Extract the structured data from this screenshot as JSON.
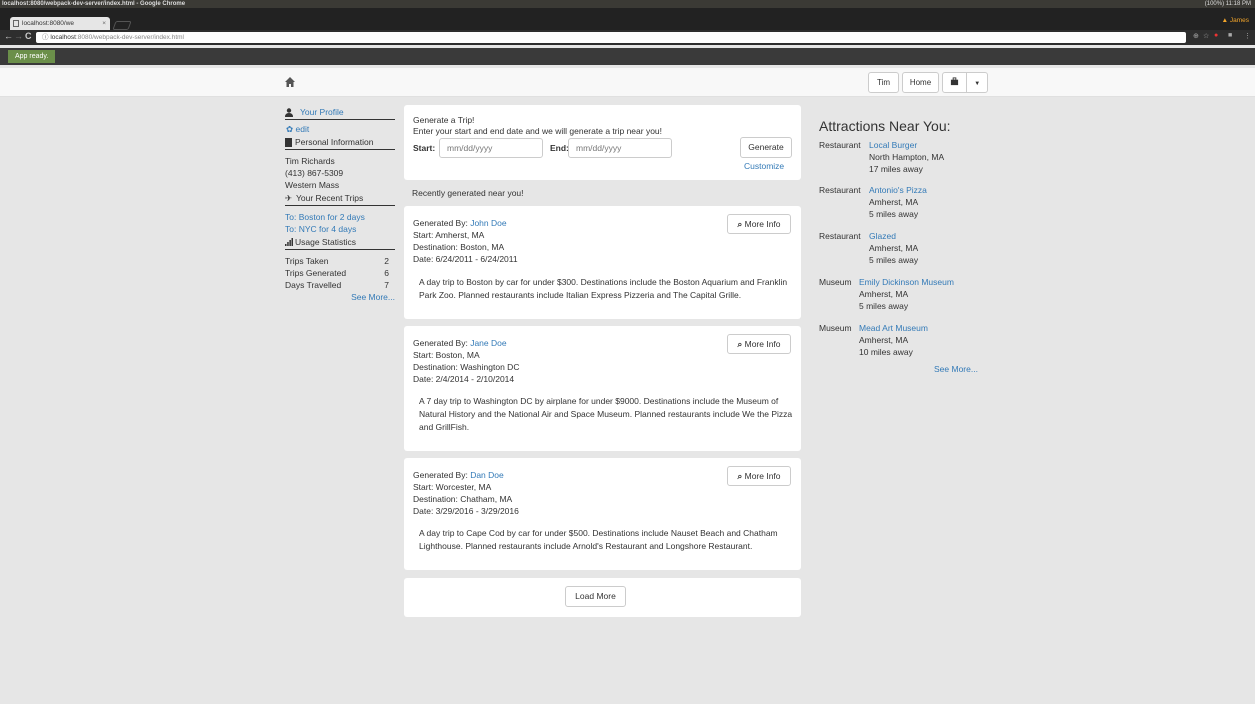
{
  "os": {
    "window_title": "localhost:8080/webpack-dev-server/index.html - Google Chrome",
    "tray": "(100%)  11:18 PM"
  },
  "browser": {
    "tab_title": "localhost:8080/we",
    "profile_name": "James",
    "url_host": "localhost",
    "url_path": ":8080/webpack-dev-server/index.html",
    "status_message": "App ready."
  },
  "navbar": {
    "user_label": "Tim",
    "home_label": "Home"
  },
  "sidebar": {
    "profile_label": "Your Profile",
    "edit_label": "edit",
    "personal_info_label": "Personal Information",
    "name": "Tim Richards",
    "phone": "(413) 867-5309",
    "region": "Western Mass",
    "recent_trips_label": "Your Recent Trips",
    "recent_trips": [
      "To: Boston for 2 days",
      "To: NYC for 4 days"
    ],
    "usage_label": "Usage Statistics",
    "stats": [
      {
        "label": "Trips Taken",
        "value": "2"
      },
      {
        "label": "Trips Generated",
        "value": "6"
      },
      {
        "label": "Days Travelled",
        "value": "7"
      }
    ],
    "see_more": "See More..."
  },
  "generator": {
    "title": "Generate a Trip!",
    "subtitle": "Enter your start and end date and we will generate a trip near you!",
    "start_label": "Start:",
    "start_placeholder": "mm/dd/yyyy",
    "end_label": "End:",
    "end_placeholder": "mm/dd/yyyy",
    "generate_label": "Generate",
    "customize_label": "Customize"
  },
  "recent_header": "Recently generated near you!",
  "trips": [
    {
      "by_label": "Generated By:",
      "by": "John Doe",
      "start": "Start: Amherst, MA",
      "destination": "Destination: Boston, MA",
      "date": "Date: 6/24/2011 - 6/24/2011",
      "more_info": "More Info",
      "description": "A day trip to Boston by car for under $300. Destinations include the Boston Aquarium and Franklin Park Zoo. Planned restaurants include Italian Express Pizzeria and The Capital Grille."
    },
    {
      "by_label": "Generated By:",
      "by": "Jane Doe",
      "start": "Start: Boston, MA",
      "destination": "Destination: Washington DC",
      "date": "Date: 2/4/2014 - 2/10/2014",
      "more_info": "More Info",
      "description": "A 7 day trip to Washington DC by airplane for under $9000. Destinations include the Museum of Natural History and the National Air and Space Museum. Planned restaurants include We the Pizza and GrillFish."
    },
    {
      "by_label": "Generated By:",
      "by": "Dan Doe",
      "start": "Start: Worcester, MA",
      "destination": "Destination: Chatham, MA",
      "date": "Date: 3/29/2016 - 3/29/2016",
      "more_info": "More Info",
      "description": "A day trip to Cape Cod by car for under $500. Destinations include Nauset Beach and Chatham Lighthouse. Planned restaurants include Arnold's Restaurant and Longshore Restaurant."
    }
  ],
  "load_more": "Load More",
  "attractions": {
    "title": "Attractions Near You:",
    "items": [
      {
        "type": "Restaurant",
        "name": "Local Burger",
        "location": "North Hampton, MA",
        "distance": "17 miles away"
      },
      {
        "type": "Restaurant",
        "name": "Antonio's Pizza",
        "location": "Amherst, MA",
        "distance": "5 miles away"
      },
      {
        "type": "Restaurant",
        "name": "Glazed",
        "location": "Amherst, MA",
        "distance": "5 miles away"
      },
      {
        "type": "Museum",
        "name": "Emily Dickinson Museum",
        "location": "Amherst, MA",
        "distance": "5 miles away"
      },
      {
        "type": "Museum",
        "name": "Mead Art Museum",
        "location": "Amherst, MA",
        "distance": "10 miles away"
      }
    ],
    "see_more": "See More..."
  }
}
